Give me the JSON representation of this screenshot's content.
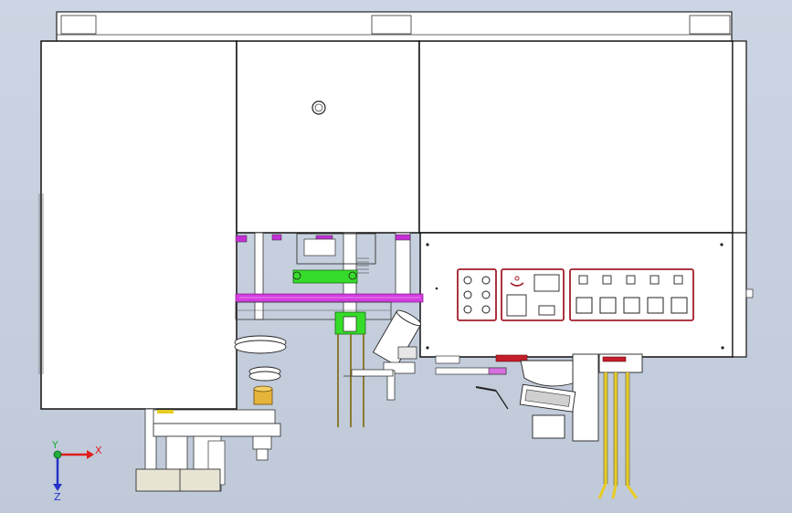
{
  "viewport": {
    "background": "#c8d1df"
  },
  "triad": {
    "x_label": "X",
    "y_label": "Y",
    "z_label": "Z",
    "x_color": "#e01c1c",
    "y_color": "#1fae3a",
    "z_color": "#2433c8"
  },
  "colors": {
    "panel_fill": "#ffffff",
    "line": "#1a1a1a",
    "accent_red": "#a21d2a",
    "accent_magenta": "#c42fd6",
    "accent_green": "#36dc2a",
    "accent_yellow": "#e7cc23",
    "accent_orange": "#e6b43a"
  },
  "control_panel": {
    "button_grid_left": {
      "rows": 3,
      "cols": 2
    },
    "top_row_buttons": 5,
    "bottom_row_buttons": 5
  }
}
